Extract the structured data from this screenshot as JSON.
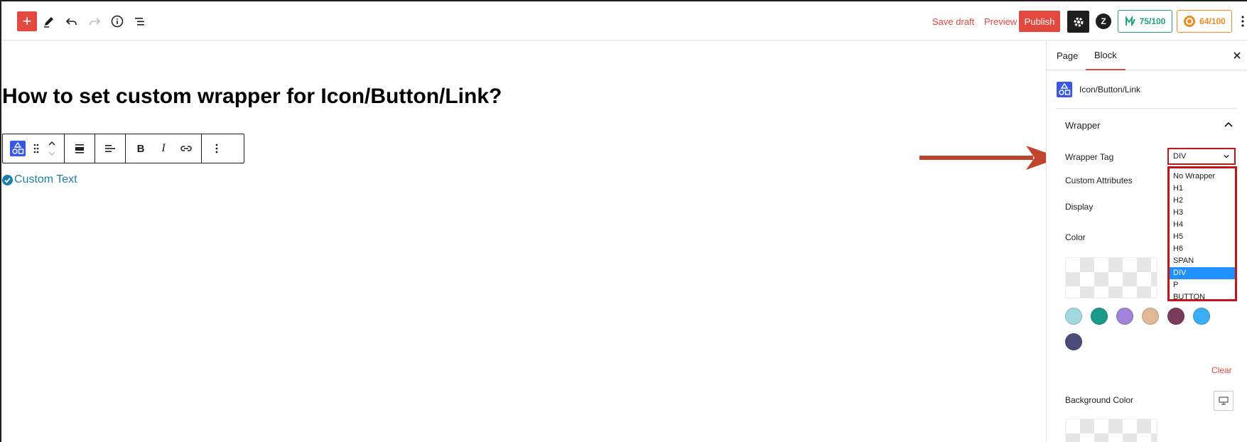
{
  "topbar": {
    "add_symbol": "+",
    "save_draft": "Save draft",
    "preview": "Preview",
    "publish": "Publish",
    "z_logo": "Z",
    "score_seo": "75/100",
    "score_readability": "64/100",
    "score_seo_color": "#1fa67a",
    "score_readability_color": "#ef8b22",
    "accent": "#e2483d"
  },
  "editor": {
    "title": "How to set custom wrapper for Icon/Button/Link?",
    "block_text": "Custom Text",
    "toolbar_bold": "B",
    "toolbar_italic": "I"
  },
  "sidebar": {
    "tabs": [
      {
        "label": "Page"
      },
      {
        "label": "Block"
      }
    ],
    "active_tab": "Block",
    "block_name": "Icon/Button/Link",
    "panel_title": "Wrapper",
    "wrapper_tag_label": "Wrapper Tag",
    "wrapper_tag_value": "DIV",
    "wrapper_options": [
      "No Wrapper",
      "H1",
      "H2",
      "H3",
      "H4",
      "H5",
      "H6",
      "SPAN",
      "DIV",
      "P",
      "BUTTON"
    ],
    "custom_attributes_label": "Custom Attributes",
    "display_label": "Display",
    "color_label": "Color",
    "swatches": [
      "#a2d8df",
      "#1a9b8a",
      "#a183d9",
      "#e0b896",
      "#7b3b5b",
      "#3aadf3",
      "#4a4d7a"
    ],
    "clear_label": "Clear",
    "background_color_label": "Background Color"
  }
}
